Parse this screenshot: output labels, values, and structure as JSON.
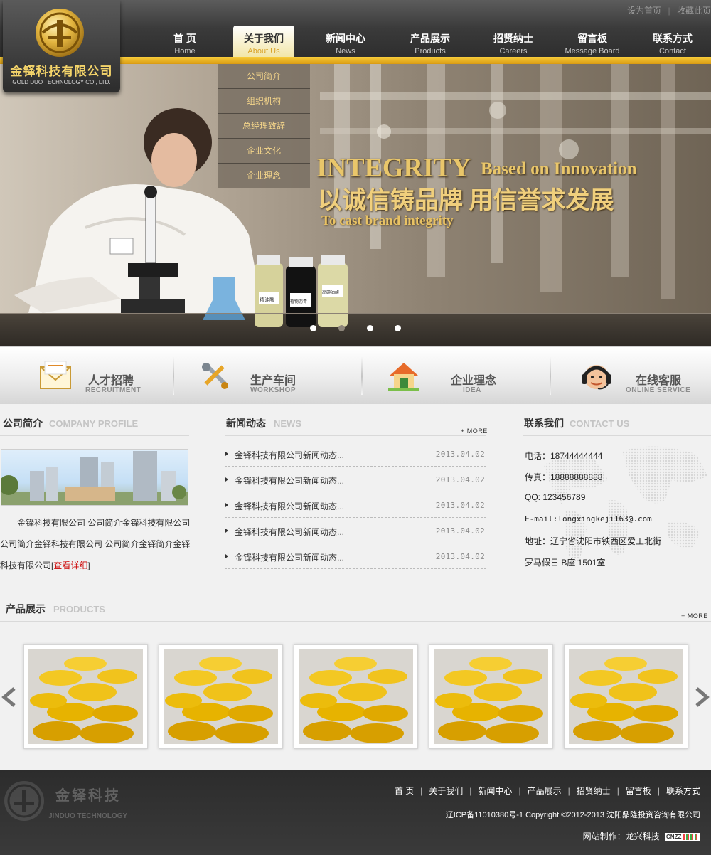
{
  "header": {
    "top_links": [
      "设为首页",
      "收藏此页"
    ],
    "logo": {
      "cn": "金铎科技有限公司",
      "en": "GOLD DUO TECHNOLOGY CO., LTD."
    },
    "nav": [
      {
        "cn": "首 页",
        "en": "Home"
      },
      {
        "cn": "关于我们",
        "en": "About Us",
        "active": true
      },
      {
        "cn": "新闻中心",
        "en": "News"
      },
      {
        "cn": "产品展示",
        "en": "Products"
      },
      {
        "cn": "招贤纳士",
        "en": "Careers"
      },
      {
        "cn": "留言板",
        "en": "Message Board"
      },
      {
        "cn": "联系方式",
        "en": "Contact"
      }
    ],
    "dropdown": [
      "公司简介",
      "组织机构",
      "总经理致辞",
      "企业文化",
      "企业理念"
    ]
  },
  "banner": {
    "slogan_en_1": "INTEGRITY",
    "slogan_en_1b": "Based on Innovation",
    "slogan_cn": "以诚信铸品牌  用信誉求发展",
    "slogan_en_2": "To cast brand integrity",
    "bottle_labels": [
      "精油酸",
      "植物沥青",
      "高碘油酸"
    ],
    "slides": 4,
    "active_slide": 3
  },
  "features": [
    {
      "title": "人才招聘",
      "sub": "RECRUITMENT",
      "icon": "envelope-icon"
    },
    {
      "title": "生产车间",
      "sub": "WORKSHOP",
      "icon": "tools-icon"
    },
    {
      "title": "企业理念",
      "sub": "IDEA",
      "icon": "house-icon"
    },
    {
      "title": "在线客服",
      "sub": "ONLINE SERVICE",
      "icon": "headset-icon"
    }
  ],
  "profile": {
    "title": "公司简介",
    "sub": "COMPANY PROFILE",
    "text": "金铎科技有限公司 公司简介金铎科技有限公司公司简介金铎科技有限公司 公司简介金铎简介金铎科技有限公司",
    "link_open": "[",
    "link": "查看详细",
    "link_close": "]"
  },
  "news": {
    "title": "新闻动态",
    "sub": "NEWS",
    "more": "+ MORE",
    "items": [
      {
        "text": "金铎科技有限公司新闻动态...",
        "date": "2013.04.02"
      },
      {
        "text": "金铎科技有限公司新闻动态...",
        "date": "2013.04.02"
      },
      {
        "text": "金铎科技有限公司新闻动态...",
        "date": "2013.04.02"
      },
      {
        "text": "金铎科技有限公司新闻动态...",
        "date": "2013.04.02"
      },
      {
        "text": "金铎科技有限公司新闻动态...",
        "date": "2013.04.02"
      }
    ]
  },
  "contact": {
    "title": "联系我们",
    "sub": "CONTACT US",
    "phone": "电话：18744444444",
    "fax": "传真：18888888888",
    "qq": "QQ:  123456789",
    "email": "E-mail:longxingkeji163@.com",
    "address_1": "地址：辽宁省沈阳市铁西区爱工北街",
    "address_2": "罗马假日 B座  1501室"
  },
  "products": {
    "title": "产品展示",
    "sub": "PRODUCTS",
    "more": "+ MORE",
    "count": 5
  },
  "footer": {
    "logo_cn": "金铎科技",
    "logo_en": "JINDUO TECHNOLOGY",
    "nav": [
      "首 页",
      "关于我们",
      "新闻中心",
      "产品展示",
      "招贤纳士",
      "留言板",
      "联系方式"
    ],
    "copyright": "辽ICP备11010380号-1 Copyright ©2012-2013 沈阳鼎隆投资咨询有限公司",
    "credit": "网站制作：龙兴科技",
    "badge": "CNZZ"
  },
  "colors": {
    "accent_gold": "#e9b82a",
    "header_dark": "#333333",
    "link_red": "#cc0000"
  }
}
